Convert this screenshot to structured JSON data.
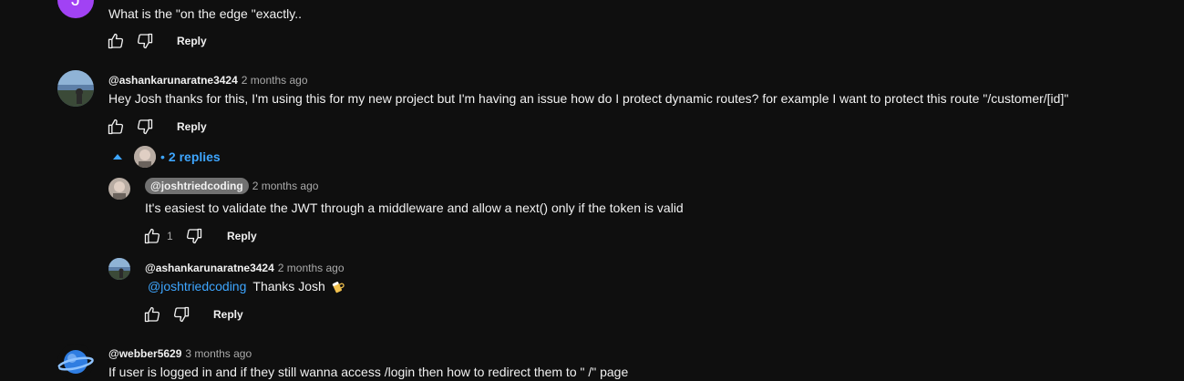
{
  "comments": [
    {
      "avatar_letter": "J",
      "avatar_color": "#a142f4",
      "text": "What is the  \"on the edge \"exactly..",
      "reply_label": "Reply"
    },
    {
      "author": "@ashankarunaratne3424",
      "time": "2 months ago",
      "text": "Hey Josh thanks for this, I'm using this for my new project but I'm having an issue how do I protect dynamic routes?  for example I want to protect this route \"/customer/[id]\"",
      "reply_label": "Reply",
      "replies_toggle": "2 replies",
      "replies_bullet": "•",
      "replies": [
        {
          "author": "@joshtriedcoding",
          "time": "2 months ago",
          "text": "It's easiest to validate the JWT through a middleware and allow a next() only if the token is valid",
          "like_count": "1",
          "reply_label": "Reply"
        },
        {
          "author": "@ashankarunaratne3424",
          "time": "2 months ago",
          "mention": "@joshtriedcoding",
          "text": "Thanks Josh",
          "reply_label": "Reply"
        }
      ]
    },
    {
      "author": "@webber5629",
      "time": "3 months ago",
      "text": "If user is logged in and if they still wanna access /login then how to redirect them to \" /\" page"
    }
  ],
  "colors": {
    "background": "#0f0f0f",
    "text": "#f1f1f1",
    "secondary": "#aaaaaa",
    "link": "#3ea6ff",
    "chip": "#717171"
  }
}
